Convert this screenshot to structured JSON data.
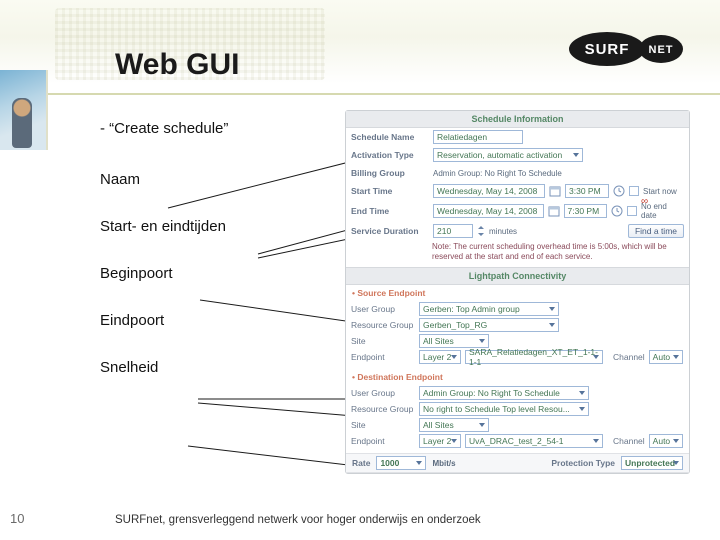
{
  "header": {
    "title": "Web GUI",
    "logo": {
      "left": "SURF",
      "right": "NET"
    }
  },
  "labels": {
    "l0": "- “Create schedule”",
    "l1": "Naam",
    "l2": "Start- en eindtijden",
    "l3": "Beginpoort",
    "l4": "Eindpoort",
    "l5": "Snelheid"
  },
  "schedule": {
    "panel_title": "Schedule Information",
    "name_label": "Schedule Name",
    "name_value": "Relatiedagen",
    "activation_label": "Activation Type",
    "activation_value": "Reservation, automatic activation",
    "billing_label": "Billing Group",
    "billing_value": "Admin Group: No Right To Schedule",
    "start_label": "Start Time",
    "start_date": "Wednesday, May 14, 2008",
    "start_time": "3:30 PM",
    "start_now": "Start now",
    "end_label": "End Time",
    "end_date": "Wednesday, May 14, 2008",
    "end_time": "7:30 PM",
    "no_end": "No end date",
    "duration_label": "Service Duration",
    "duration_value": "210",
    "duration_unit": "minutes",
    "find_time": "Find a time",
    "note": "Note: The current scheduling overhead time is 5:00s, which will be reserved at the start and end of each service."
  },
  "connectivity": {
    "panel_title": "Lightpath Connectivity",
    "source_title": "• Source Endpoint",
    "dest_title": "• Destination Endpoint",
    "user_group_label": "User Group",
    "resource_group_label": "Resource Group",
    "site_label": "Site",
    "endpoint_label": "Endpoint",
    "channel_label": "Channel",
    "src_user_group": "Gerben: Top Admin group",
    "src_resource_group": "Gerben_Top_RG",
    "src_site": "All Sites",
    "src_layer": "Layer 2",
    "src_endpoint": "SARA_Relatiedagen_XT_ET_1-1-1-1",
    "src_channel": "Auto",
    "dst_user_group": "Admin Group: No Right To Schedule",
    "dst_resource_group": "No right to Schedule Top level Resou...",
    "dst_site": "All Sites",
    "dst_layer": "Layer 2",
    "dst_endpoint": "UvA_DRAC_test_2_54-1",
    "dst_channel": "Auto",
    "rate_label": "Rate",
    "rate_value": "1000",
    "rate_unit": "Mbit/s",
    "protection_label": "Protection Type",
    "protection_value": "Unprotected"
  },
  "footer": {
    "page": "10",
    "text": "SURFnet, grensverleggend netwerk voor hoger onderwijs en onderzoek"
  }
}
